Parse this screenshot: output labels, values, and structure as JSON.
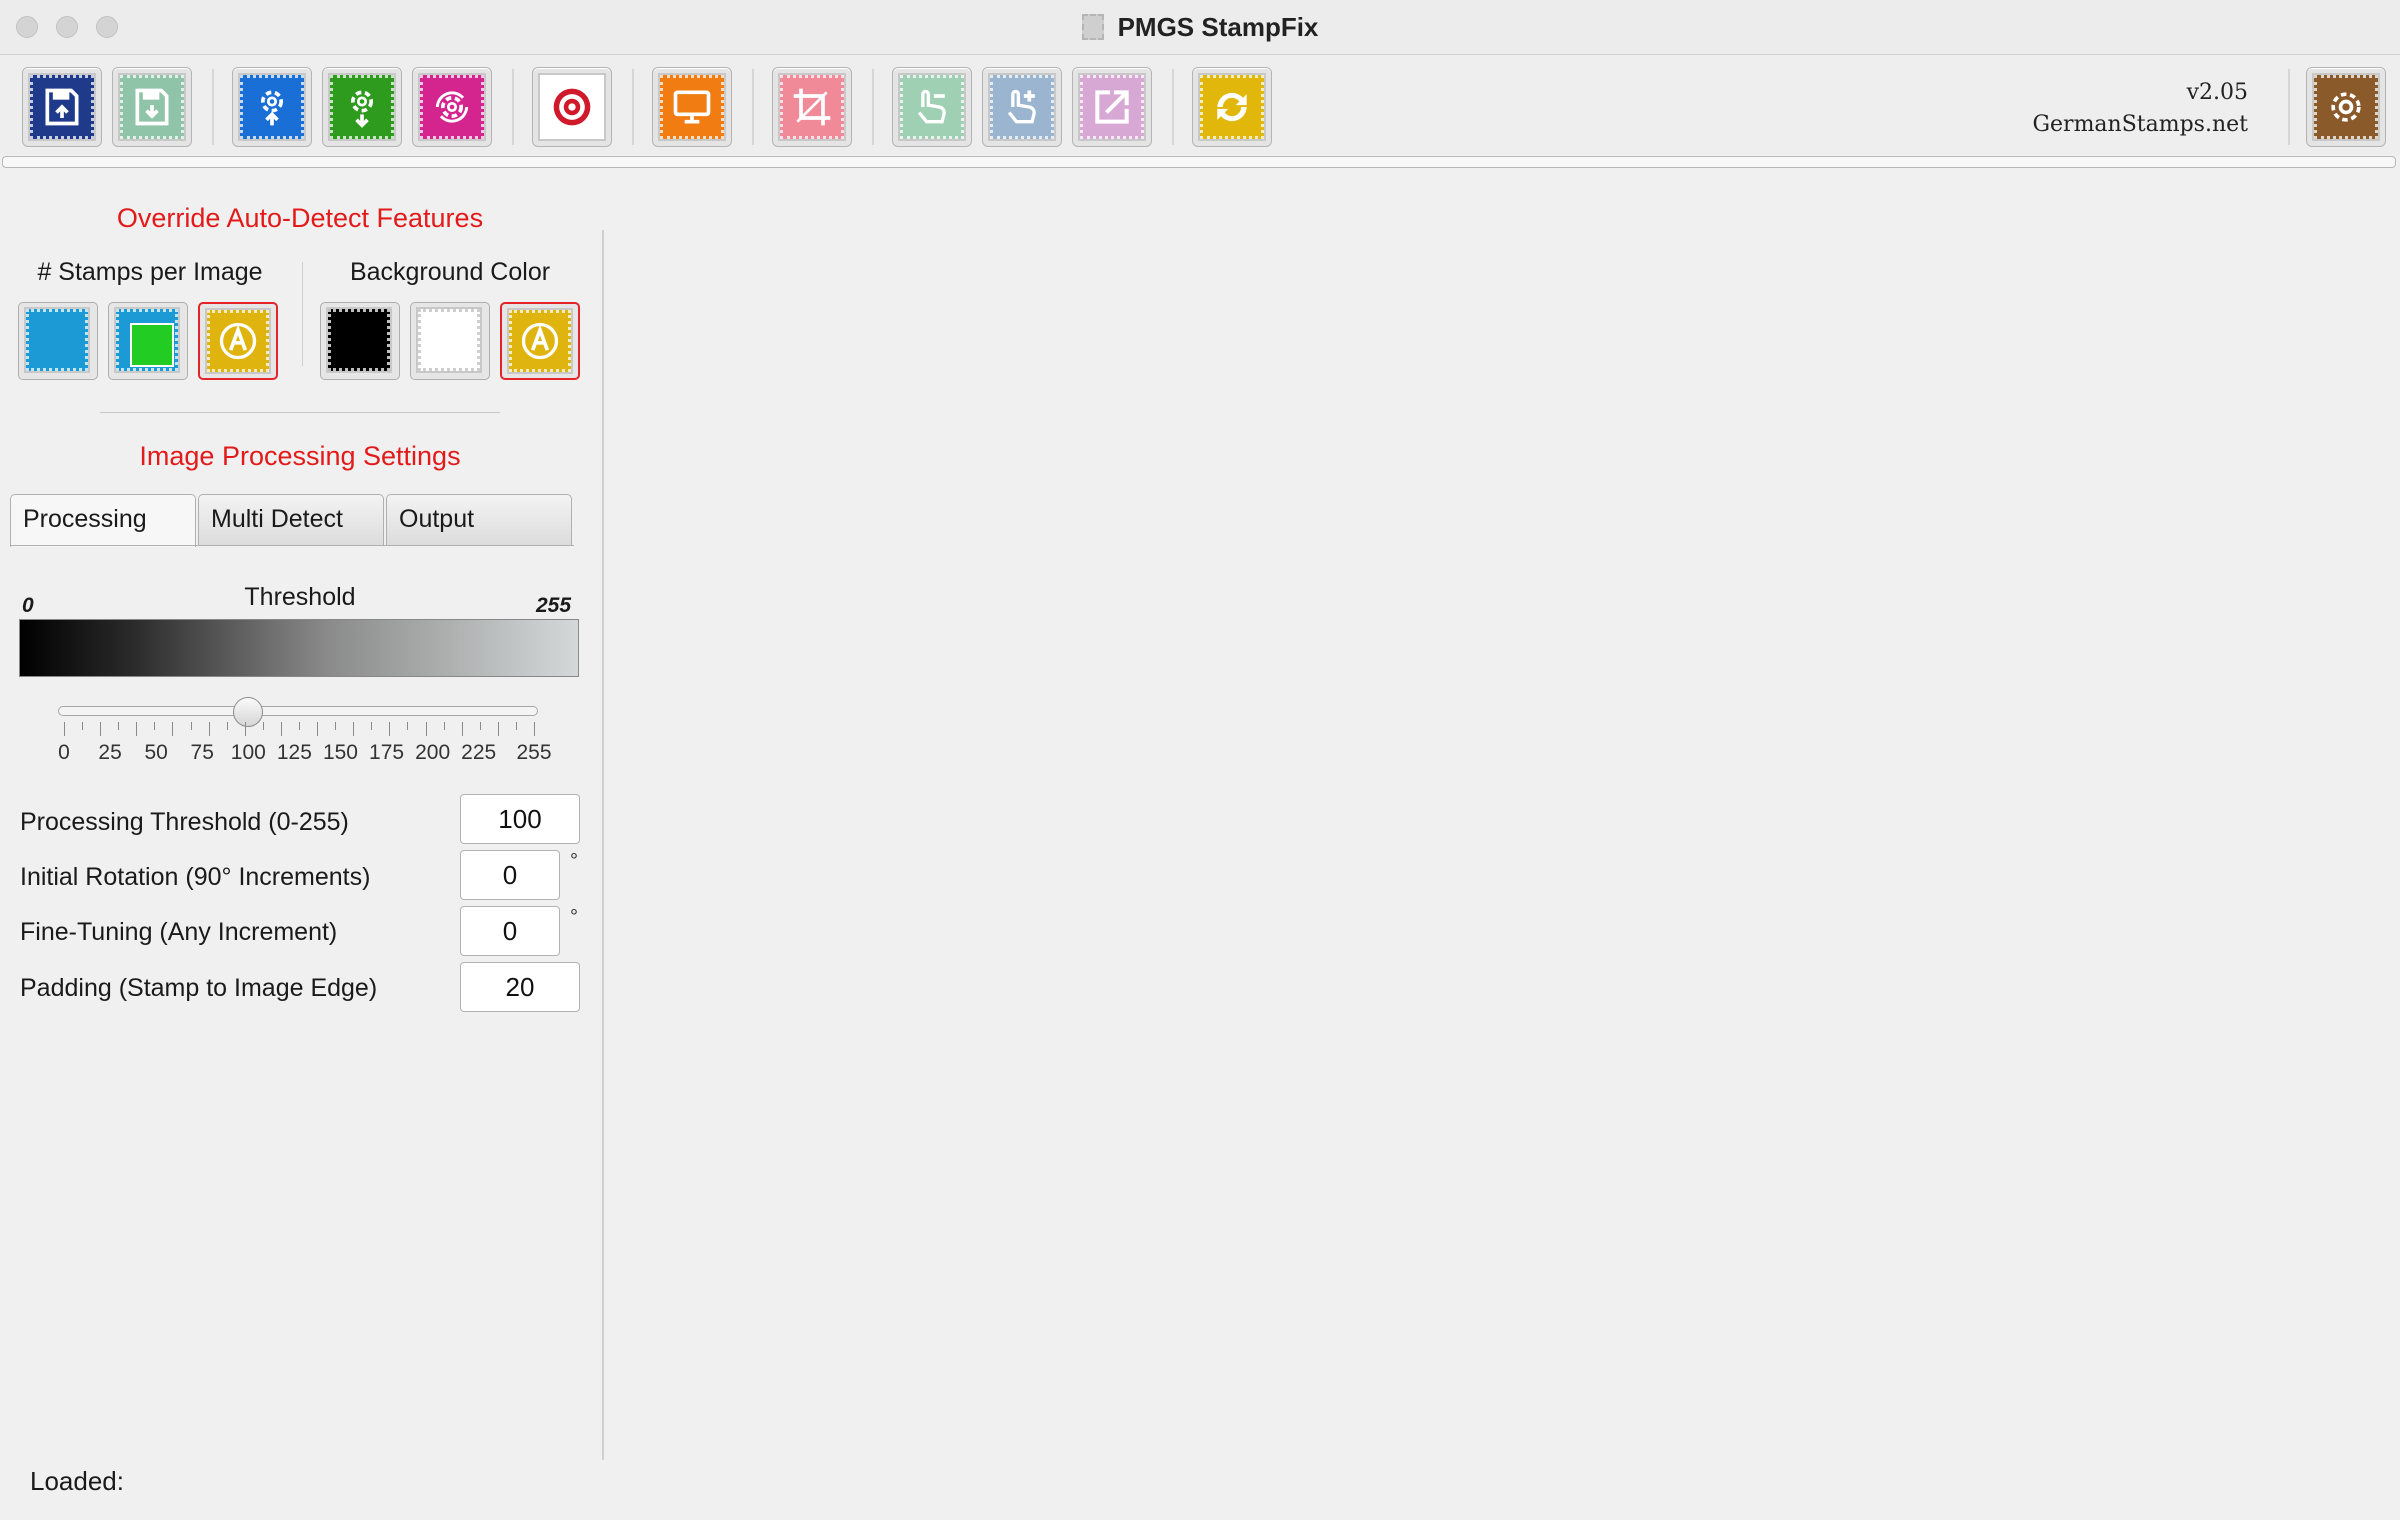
{
  "window": {
    "title": "PMGS StampFix"
  },
  "toolbar": {
    "version": "v2.05",
    "website": "GermanStamps.net",
    "buttons": [
      {
        "name": "save-button",
        "icon": "save-floppy-icon",
        "color": "#1f3a8a",
        "enabled": true
      },
      {
        "name": "save-as-button",
        "icon": "save-download-icon",
        "color": "#8fc4a8",
        "enabled": false
      },
      {
        "name": "settings-upload-button",
        "icon": "gear-upload-icon",
        "color": "#1a6fd6",
        "enabled": true
      },
      {
        "name": "settings-download-button",
        "icon": "gear-download-icon",
        "color": "#2e9a1e",
        "enabled": true
      },
      {
        "name": "settings-reset-button",
        "icon": "gear-reset-icon",
        "color": "#d4258f",
        "enabled": true
      },
      {
        "name": "target-button",
        "icon": "target-icon",
        "color": "#d0192b",
        "enabled": true
      },
      {
        "name": "preview-button",
        "icon": "monitor-icon",
        "color": "#f07c12",
        "enabled": true
      },
      {
        "name": "crop-button",
        "icon": "crop-icon",
        "color": "#f08a98",
        "enabled": false
      },
      {
        "name": "hand-remove-button",
        "icon": "hand-minus-icon",
        "color": "#9fd0b4",
        "enabled": false
      },
      {
        "name": "hand-add-button",
        "icon": "hand-plus-icon",
        "color": "#9bb4cf",
        "enabled": false
      },
      {
        "name": "export-button",
        "icon": "export-arrow-icon",
        "color": "#d8a8d4",
        "enabled": false
      },
      {
        "name": "refresh-button",
        "icon": "refresh-icon",
        "color": "#e2b70c",
        "enabled": true
      },
      {
        "name": "preferences-button",
        "icon": "gear-icon",
        "color": "#8a5a2a",
        "enabled": true
      }
    ]
  },
  "override": {
    "title": "Override Auto-Detect Features",
    "stamps_label": "# Stamps per Image",
    "background_label": "Background Color",
    "stamp_buttons": [
      {
        "name": "single-stamp-button",
        "icon": "single-stamp-icon",
        "color": "#1c9ad6",
        "selected": false
      },
      {
        "name": "multi-stamp-button",
        "icon": "multi-stamp-icon",
        "color": "#22cc22",
        "selected": false
      },
      {
        "name": "auto-stamp-button",
        "icon": "auto-icon",
        "color": "#e0b40e",
        "selected": true
      }
    ],
    "bg_buttons": [
      {
        "name": "black-background-button",
        "icon": "black-swatch-icon",
        "color": "#000000",
        "selected": false
      },
      {
        "name": "white-background-button",
        "icon": "white-swatch-icon",
        "color": "#ffffff",
        "selected": false
      },
      {
        "name": "auto-background-button",
        "icon": "auto-icon",
        "color": "#e0b40e",
        "selected": true
      }
    ]
  },
  "processing": {
    "title": "Image Processing Settings",
    "tabs": [
      {
        "label": "Processing",
        "active": true
      },
      {
        "label": "Multi Detect",
        "active": false
      },
      {
        "label": "Output",
        "active": false
      }
    ],
    "threshold_label": "Threshold",
    "gradient_min": "0",
    "gradient_max": "255",
    "slider": {
      "min": 0,
      "max": 255,
      "value": 100,
      "tick_labels": [
        "0",
        "25",
        "50",
        "75",
        "100",
        "125",
        "150",
        "175",
        "200",
        "225",
        "255"
      ]
    },
    "fields": [
      {
        "label": "Processing Threshold (0-255)",
        "value": "100",
        "unit": ""
      },
      {
        "label": "Initial Rotation (90° Increments)",
        "value": "0",
        "unit": "°"
      },
      {
        "label": "Fine-Tuning (Any Increment)",
        "value": "0",
        "unit": "°"
      },
      {
        "label": "Padding (Stamp to Image Edge)",
        "value": "20",
        "unit": ""
      }
    ]
  },
  "status": {
    "loaded_label": "Loaded:"
  }
}
